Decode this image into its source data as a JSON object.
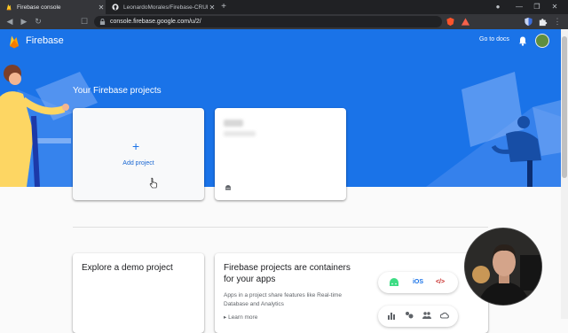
{
  "browser": {
    "tabs": [
      {
        "label": "Firebase console",
        "active": true
      },
      {
        "label": "LeonardoMorales/Firebase-CRUD-Jetp",
        "active": false
      }
    ],
    "address": "console.firebase.google.com/u/2/"
  },
  "header": {
    "brand": "Firebase",
    "docs_link": "Go to docs"
  },
  "hero": {
    "title": "Your Firebase projects"
  },
  "add_project": {
    "plus": "+",
    "label": "Add project"
  },
  "demo": {
    "title": "Explore a demo project"
  },
  "info": {
    "title": "Firebase projects are containers for your apps",
    "description": "Apps in a project share features like Real-time Database and Analytics",
    "learn_more": "Learn more"
  },
  "platforms": {
    "ios_label": "iOS",
    "web_label": "</>"
  },
  "colors": {
    "firebase_blue": "#1a73e8",
    "android_green": "#3ddc84",
    "web_red": "#c5221f"
  }
}
